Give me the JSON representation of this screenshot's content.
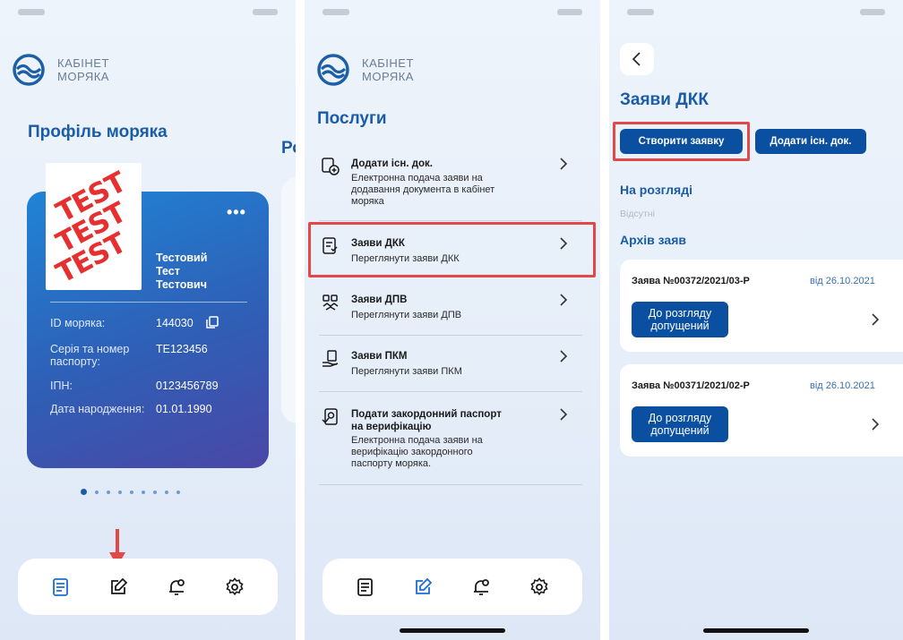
{
  "logo": {
    "line1": "КАБІНЕТ",
    "line2": "МОРЯКА"
  },
  "screen1": {
    "title": "Профіль моряка",
    "peek_title": "Ро",
    "stamp": [
      "TEST",
      "TEST",
      "TEST"
    ],
    "more": "•••",
    "name": [
      "Тестовий",
      "Тест",
      "Тестович"
    ],
    "rows": [
      {
        "label": "ID моряка:",
        "value": "144030"
      },
      {
        "label": "Серія та номер паспорту:",
        "value": "TE123456"
      },
      {
        "label": "ІПН:",
        "value": "0123456789"
      },
      {
        "label": "Дата народження:",
        "value": "01.01.1990"
      }
    ],
    "page_indicator": {
      "count": 9,
      "active": 1
    }
  },
  "screen2": {
    "title": "Послуги",
    "services": [
      {
        "title": "Додати існ. док.",
        "desc": "Електронна подача заяви на додавання документа в кабінет моряка",
        "icon": "add-document-icon"
      },
      {
        "title": "Заяви ДКК",
        "desc": "Переглянути заяви ДКК",
        "icon": "dkk-document-icon"
      },
      {
        "title": "Заяви ДПВ",
        "desc": "Переглянути заяви ДПВ",
        "icon": "dpv-handshake-icon"
      },
      {
        "title": "Заяви ПКМ",
        "desc": "Переглянути заяви ПКМ",
        "icon": "pkm-hand-icon"
      },
      {
        "title": "Подати закордонний паспорт на верифікацію",
        "desc": "Електронна подача заяви на верифікацію закордонного паспорту моряка.",
        "icon": "passport-verify-icon"
      }
    ]
  },
  "screen3": {
    "title": "Заяви ДКК",
    "create_btn": "Створити заявку",
    "add_btn": "Додати існ. док.",
    "review_heading": "На розгляді",
    "review_empty": "Відсутні",
    "archive_heading": "Архів заяв",
    "applications": [
      {
        "number": "Заява №00372/2021/03-Р",
        "date": "від 26.10.2021",
        "status": "До розгляду допущений"
      },
      {
        "number": "Заява №00371/2021/02-Р",
        "date": "від 26.10.2021",
        "status": "До розгляду допущений"
      }
    ]
  },
  "tabbar": {
    "icons": [
      "documents-icon",
      "services-edit-icon",
      "notifications-bell-icon",
      "settings-gear-icon"
    ],
    "active_color": "#1a6fd1",
    "inactive_color": "#1a1a1a"
  },
  "colors": {
    "primary": "#1a5ca8",
    "button": "#0b4fa0",
    "highlight": "#e24848"
  }
}
